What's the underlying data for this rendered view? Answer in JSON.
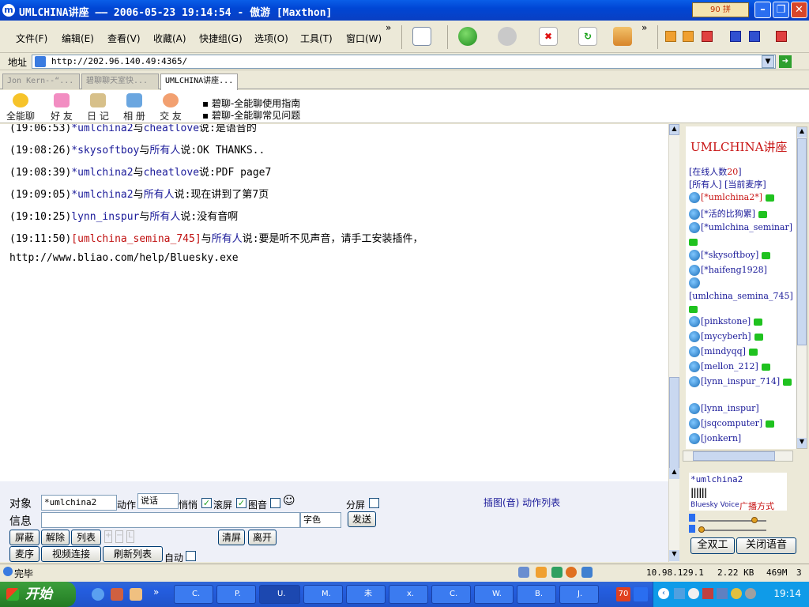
{
  "window": {
    "title": "UMLCHINA讲座 —— 2006-05-23 19:14:54 - 傲游 [Maxthon]",
    "icon": "maxthon-icon",
    "extra_badge": "90 拼"
  },
  "menu": {
    "items": [
      "文件(F)",
      "编辑(E)",
      "查看(V)",
      "收藏(A)",
      "快捷组(G)",
      "选项(O)",
      "工具(T)",
      "窗口(W)"
    ],
    "overflow": "»"
  },
  "address": {
    "label": "地址",
    "url": "http://202.96.140.49:4365/"
  },
  "tabs": [
    {
      "label": "Jon Kern--“..."
    },
    {
      "label": "碧聊聊天室快..."
    },
    {
      "label": "UMLCHINA讲座..."
    }
  ],
  "app_toolbar": {
    "buttons": [
      "全能聊",
      "好 友",
      "日 记",
      "相 册",
      "交 友"
    ],
    "links": [
      "▪ 碧聊-全能聊使用指南",
      "▪ 碧聊-全能聊常见问题"
    ]
  },
  "chat": {
    "messages": [
      {
        "time": "(19:06:53)",
        "from": "*umlchina2",
        "verb": "与",
        "to": "cheatlove",
        "say": "说:",
        "text": "是语音的"
      },
      {
        "time": "(19:08:26)",
        "from": "*skysoftboy",
        "verb": "与",
        "to": "所有人",
        "say": "说:",
        "text": "OK THANKS.."
      },
      {
        "time": "(19:08:39)",
        "from": "*umlchina2",
        "verb": "与",
        "to": "cheatlove",
        "say": "说:",
        "text": "PDF page7"
      },
      {
        "time": "(19:09:05)",
        "from": "*umlchina2",
        "verb": "与",
        "to": "所有人",
        "say": "说:",
        "text": "现在讲到了第7页"
      },
      {
        "time": "(19:10:25)",
        "from": "lynn_inspur",
        "verb": "与",
        "to": "所有人",
        "say": "说:",
        "text": "没有音啊"
      },
      {
        "time": "(19:11:50)",
        "from": "[umlchina_semina_745]",
        "verb": "与",
        "to": "所有人",
        "say": "说:",
        "text": "要是听不见声音，请手工安装插件，"
      }
    ],
    "url_line": "http://www.bliao.com/help/Bluesky.exe"
  },
  "room": {
    "title": "UMLCHINA讲座",
    "online_label": "[在线人数",
    "online_count": "20",
    "online_close": "]",
    "tabs_text": "[所有人] [当前麦序]",
    "users": [
      {
        "name": "[*umlchina2*]",
        "color": "#c81414",
        "phone": true
      },
      {
        "name": "[*活的比狗累]",
        "color": "#1a1a99",
        "phone": true
      },
      {
        "name": "[*umlchina_seminar]",
        "color": "#1a1a99",
        "phone": true,
        "wrap": true
      },
      {
        "name": "[*skysoftboy]",
        "color": "#1a1a99",
        "phone": true
      },
      {
        "name": "[*haifeng1928]",
        "color": "#1a1a99",
        "phone": false
      },
      {
        "name": "[umlchina_semina_745]",
        "color": "#1a1a99",
        "phone": true,
        "wrap": true,
        "noavatar_line": true
      },
      {
        "name": "[pinkstone]",
        "color": "#1a1a99",
        "phone": true
      },
      {
        "name": "[mycyberh]",
        "color": "#1a1a99",
        "phone": true
      },
      {
        "name": "[mindyqq]",
        "color": "#1a1a99",
        "phone": true
      },
      {
        "name": "[mellon_212]",
        "color": "#1a1a99",
        "phone": true
      },
      {
        "name": "[lynn_inspur_714]",
        "color": "#1a1a99",
        "phone": true
      },
      {
        "name": "[lynn_inspur]",
        "color": "#1a1a99",
        "phone": false
      },
      {
        "name": "[jsqcomputer]",
        "color": "#1a1a99",
        "phone": true
      },
      {
        "name": "[jonkern]",
        "color": "#1a1a99",
        "phone": false
      }
    ]
  },
  "controls": {
    "target_label": "对象",
    "target_value": "*umlchina2",
    "action_label": "动作",
    "say_value": "说话",
    "whisper_label": "悄悄",
    "scroll_label": "滚屏",
    "sound_label": "图音",
    "smiley": "☺",
    "split_label": "分屏",
    "insert_links": "插图(音) 动作列表",
    "message_label": "信息",
    "message_value": "",
    "font_color": "字色",
    "send": "发送",
    "row3": [
      "屏蔽",
      "解除",
      "列表"
    ],
    "clear": "清屏",
    "leave": "离开",
    "mic_order": "麦序",
    "video": "视频连接",
    "refresh": "刷新列表",
    "auto_label": "自动"
  },
  "voice": {
    "speaker": "*umlchina2",
    "brand": "Bluesky Voice",
    "mode": "广播方式",
    "full_duplex": "全双工",
    "close_voice": "关闭语音",
    "volume_level": 0.82
  },
  "status": {
    "text": "完毕",
    "ip": "10.98.129.1",
    "speed": "2.22 KB",
    "memory": "469M",
    "count": "3"
  },
  "taskbar": {
    "start": "开始",
    "tasks": [
      "C.",
      "P.",
      "U.",
      "M.",
      "未",
      "x.",
      "C.",
      "W.",
      "B.",
      "J."
    ],
    "clock": "19:14",
    "tray_badge": "70"
  }
}
